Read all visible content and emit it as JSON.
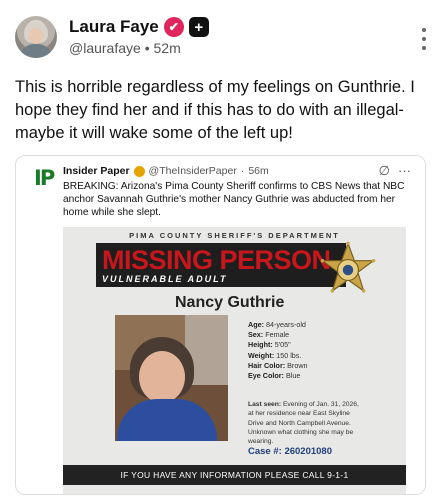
{
  "post": {
    "display_name": "Laura Faye",
    "handle": "@laurafaye",
    "separator": "•",
    "time": "52m",
    "text": "This is horrible regardless of my feelings on Gunthrie. I hope they find her and if this has to do with an illegal- maybe it will wake some of the left up!"
  },
  "quote": {
    "logo": "IP",
    "name": "Insider Paper",
    "handle": "@TheInsiderPaper",
    "time_sep": "·",
    "time": "56m",
    "grok_icon": "∅",
    "more_icon": "···",
    "text": "BREAKING: Arizona's Pima County Sheriff confirms to CBS News that NBC anchor Savannah Guthrie's mother Nancy Guthrie was abducted from her home while she slept."
  },
  "poster": {
    "department": "PIMA COUNTY SHERIFF'S DEPARTMENT",
    "headline": "MISSING PERSON",
    "subheadline": "VULNERABLE ADULT",
    "person_name": "Nancy Guthrie",
    "details": [
      {
        "label": "Age:",
        "value": "84-years-old"
      },
      {
        "label": "Sex:",
        "value": "Female"
      },
      {
        "label": "Height:",
        "value": "5'05\""
      },
      {
        "label": "Weight:",
        "value": "150 lbs."
      },
      {
        "label": "Hair Color:",
        "value": "Brown"
      },
      {
        "label": "Eye Color:",
        "value": "Blue"
      }
    ],
    "last_seen_label": "Last seen:",
    "last_seen_text": "Evening of Jan. 31, 2026, at her residence near East Skyline Drive and North Campbell Avenue. Unknown what clothing she may be wearing.",
    "case_label": "Case #:",
    "case_number": "260201080",
    "footer": "IF YOU HAVE ANY INFORMATION PLEASE CALL 9-1-1"
  },
  "icons": {
    "verified": "verified-badge-icon",
    "plus": "plus-icon",
    "more": "more-vertical-icon"
  },
  "colors": {
    "verified": "#e0245e",
    "missing_red": "#c8161d",
    "case_blue": "#1f3e7a",
    "ip_green": "#1a7a2a"
  }
}
